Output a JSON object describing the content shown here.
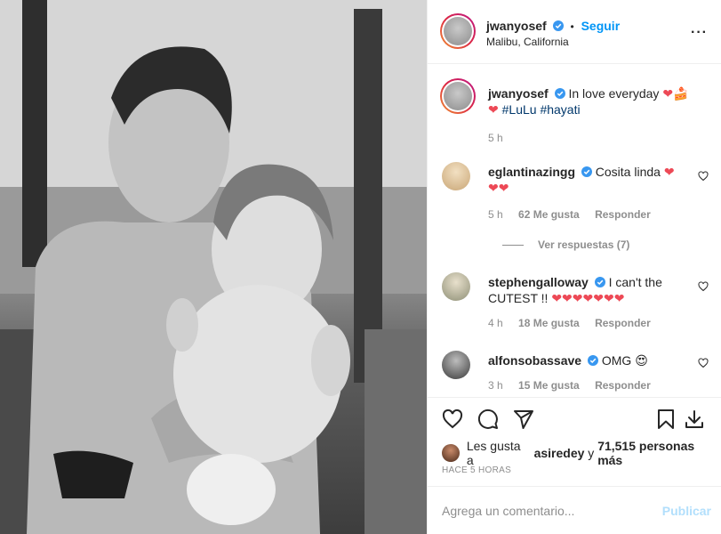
{
  "post": {
    "author": "jwanyosef",
    "location": "Malibu, California",
    "follow_label": "Seguir",
    "separator": "•"
  },
  "caption": {
    "username": "jwanyosef",
    "text_line1": "In love everyday",
    "hashtags": "#LuLu #hayati",
    "time": "5 h"
  },
  "comments": [
    {
      "username": "eglantinazingg",
      "text": "Cosita linda",
      "time": "5 h",
      "likes": "62 Me gusta",
      "reply_label": "Responder",
      "view_replies": "Ver respuestas (7)"
    },
    {
      "username": "stephengalloway",
      "text_line1": "I can't the",
      "text_line2": "CUTEST !!",
      "time": "4 h",
      "likes": "18 Me gusta",
      "reply_label": "Responder"
    },
    {
      "username": "alfonsobassave",
      "text": "OMG",
      "time": "3 h",
      "likes": "15 Me gusta",
      "reply_label": "Responder"
    }
  ],
  "likes": {
    "prefix": "Les gusta a",
    "user": "asiredey",
    "conj": "y",
    "count": "71,515 personas más"
  },
  "timestamp": "Hace 5 horas",
  "add_comment": {
    "placeholder": "Agrega un comentario...",
    "publish_label": "Publicar"
  },
  "icons": {
    "like": "heart-icon",
    "comment": "comment-icon",
    "share": "share-icon",
    "save": "bookmark-icon",
    "download": "download-icon",
    "more": "more-options-icon"
  },
  "colors": {
    "link": "#0095f6",
    "hashtag": "#00376b",
    "heart": "#ed4956",
    "verified": "#3897f0",
    "publish_disabled": "#b2dffc"
  }
}
